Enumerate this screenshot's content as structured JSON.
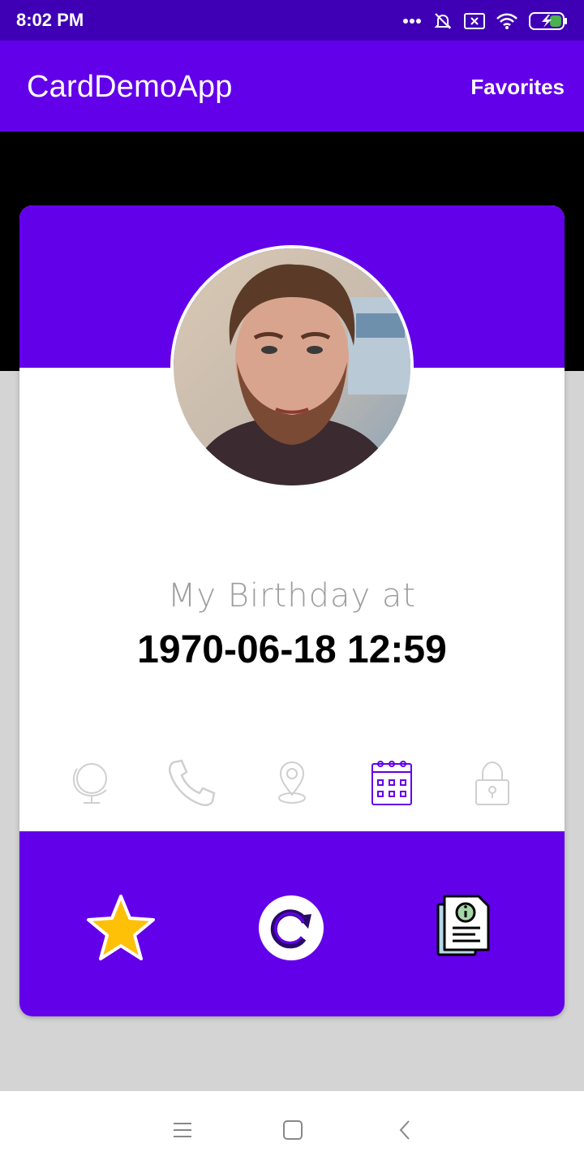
{
  "status_bar": {
    "time": "8:02 PM",
    "icons": [
      "more-dots-icon",
      "muted-bell-icon",
      "sim-x-icon",
      "wifi-icon",
      "battery-charging-icon"
    ]
  },
  "app_bar": {
    "title": "CardDemoApp",
    "action_label": "Favorites"
  },
  "card": {
    "avatar": "profile-photo",
    "birthday_label": "My Birthday at",
    "birthday_value": "1970-06-18 12:59",
    "info_icons": [
      {
        "name": "globe-icon",
        "active": false
      },
      {
        "name": "phone-icon",
        "active": false
      },
      {
        "name": "location-pin-icon",
        "active": false
      },
      {
        "name": "calendar-icon",
        "active": true
      },
      {
        "name": "lock-icon",
        "active": false
      }
    ],
    "actions": [
      "star-icon",
      "refresh-icon",
      "info-document-icon"
    ]
  },
  "nav_bar": {
    "buttons": [
      "menu-icon",
      "home-icon",
      "back-icon"
    ]
  },
  "colors": {
    "status_bar": "#3f00b5",
    "primary": "#6200ea",
    "page_background": "#d4d4d4",
    "inactive_icon": "#cfcfcf",
    "active_icon": "#6200ea",
    "star": "#ffc107"
  }
}
